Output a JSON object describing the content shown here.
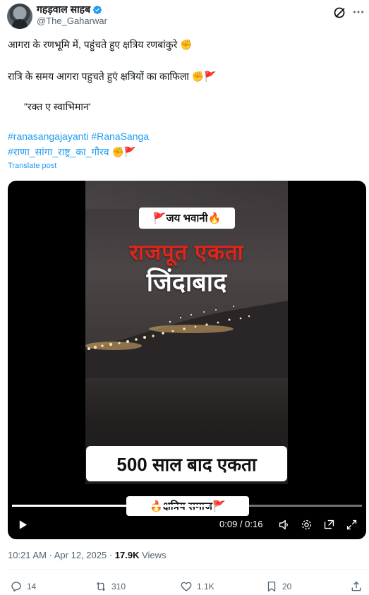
{
  "author": {
    "display_name": "गहड़वाल साहब",
    "handle": "@The_Gaharwar"
  },
  "post": {
    "line1": "आगरा के रणभूमि में, पहुंचते हुए क्षत्रिय रणबांकुरे ✊",
    "line2": "रात्रि के समय  आगरा पहुचते हुएं क्षत्रियों का काफिला ✊🚩",
    "line3": "\"रक्त ए स्वाभिमान'",
    "hashtags_line1": "#ranasangajayanti  #RanaSanga",
    "hashtags_line2": "#राणा_सांगा_राष्ट्र_का_गौरव",
    "hashtags_line2_suffix": "✊🚩",
    "translate_label": "Translate post"
  },
  "video": {
    "overlay_top": "🚩जय भवानी🔥",
    "overlay_red": "राजपूत  एकता",
    "overlay_white": "जिंदाबाद",
    "overlay_banner": "500 साल बाद एकता",
    "overlay_bottom": "🔥क्षत्रिय समाज🚩",
    "time_display": "0:09 / 0:16",
    "progress_fraction": 0.5625
  },
  "meta": {
    "time": "10:21 AM · Apr 12, 2025 · ",
    "views_count": "17.9K",
    "views_label": " Views"
  },
  "actions": {
    "replies": "14",
    "reposts": "310",
    "likes": "1.1K",
    "bookmarks": "20"
  },
  "icons": [
    "verified-badge-icon",
    "grok-icon",
    "more-icon",
    "play-icon",
    "volume-icon",
    "settings-icon",
    "pip-icon",
    "fullscreen-icon",
    "reply-icon",
    "repost-icon",
    "like-icon",
    "bookmark-icon",
    "share-icon"
  ],
  "colors": {
    "accent": "#1d9bf0",
    "text": "#0f1419",
    "secondary": "#536471",
    "overlay_red": "#e0251b"
  }
}
